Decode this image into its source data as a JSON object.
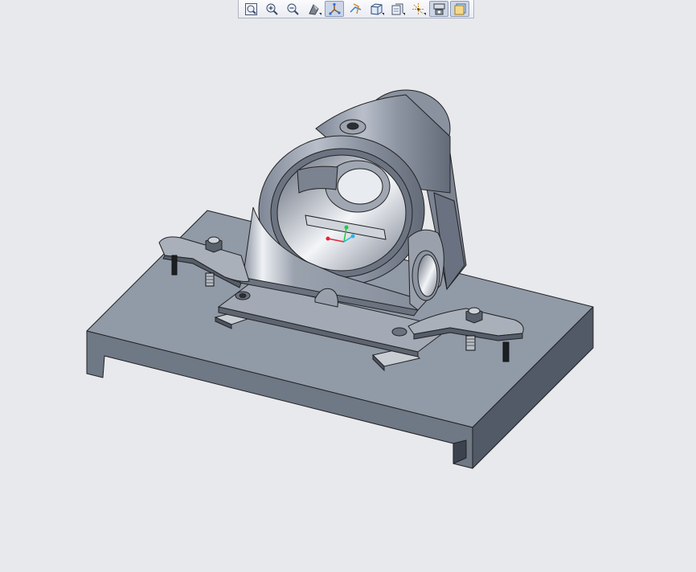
{
  "toolbar": {
    "buttons": [
      {
        "name": "zoom-fit-icon",
        "active": false,
        "dropdown": false
      },
      {
        "name": "zoom-in-icon",
        "active": false,
        "dropdown": false
      },
      {
        "name": "zoom-out-icon",
        "active": false,
        "dropdown": false
      },
      {
        "name": "shading-style-icon",
        "active": false,
        "dropdown": true
      },
      {
        "name": "datum-display-icon",
        "active": true,
        "dropdown": false
      },
      {
        "name": "annotation-display-icon",
        "active": false,
        "dropdown": false
      },
      {
        "name": "saved-views-icon",
        "active": false,
        "dropdown": true
      },
      {
        "name": "view-manager-icon",
        "active": false,
        "dropdown": true
      },
      {
        "name": "spin-center-icon",
        "active": false,
        "dropdown": true
      },
      {
        "name": "orient-mode-icon",
        "active": true,
        "dropdown": false
      },
      {
        "name": "layers-icon",
        "active": true,
        "dropdown": false
      }
    ]
  },
  "viewport": {
    "background": "#e8e9ed",
    "model_color": "#8e96a4",
    "triad_colors": {
      "x": "#e8213a",
      "y": "#22c94a",
      "z": "#2ab7e8"
    }
  }
}
